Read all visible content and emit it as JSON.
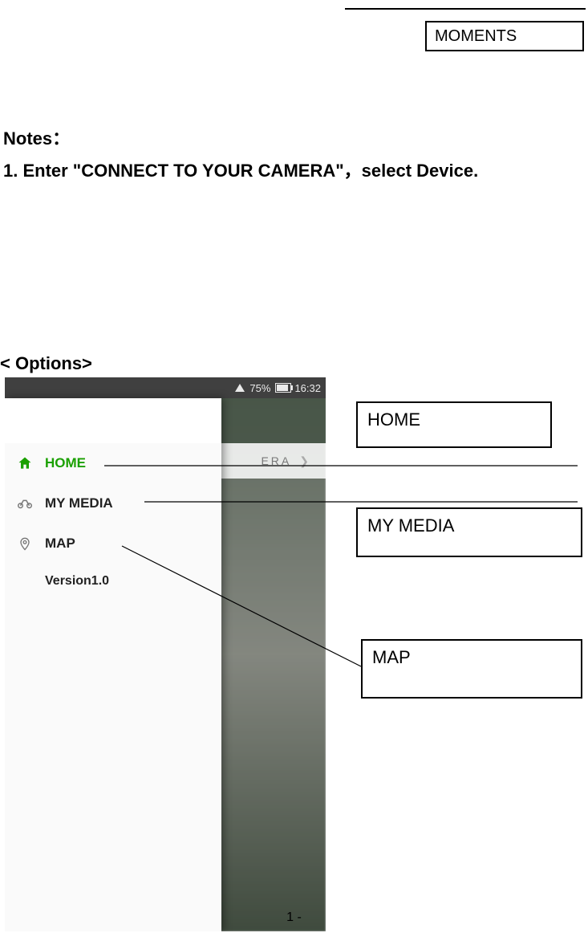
{
  "top_label": "MOMENTS",
  "notes": {
    "title": "Notes：",
    "line1": "1. Enter \"CONNECT TO YOUR CAMERA\"，select Device."
  },
  "options_heading": "< Options>",
  "labels": {
    "home": "HOME",
    "my_media": "MY MEDIA",
    "map": "MAP"
  },
  "phone": {
    "status": {
      "battery_pct": "75%",
      "time": "16:32"
    },
    "connect_text": "ERA",
    "drawer": {
      "items": [
        {
          "label": "HOME"
        },
        {
          "label": "MY MEDIA"
        },
        {
          "label": "MAP"
        }
      ],
      "version": "Version1.0"
    }
  },
  "page_number": "1 -"
}
